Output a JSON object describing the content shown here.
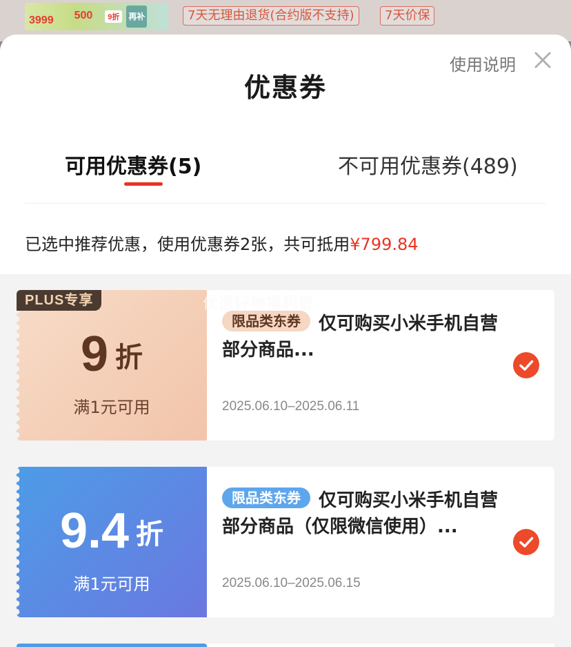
{
  "background": {
    "banner": {
      "left_price": "3999",
      "mid_value": "500",
      "tag": "9折",
      "right": "再补"
    },
    "chips": [
      "7天无理由退货(合约版不支持)",
      "7天价保"
    ]
  },
  "sheet": {
    "title": "优惠券",
    "help_label": "使用说明",
    "close_icon": "close-icon",
    "tabs": [
      {
        "label": "可用优惠券(5)",
        "active": true
      },
      {
        "label": "不可用优惠券(489)",
        "active": false
      }
    ],
    "summary": {
      "text": "已选中推荐优惠，使用优惠券2张，共可抵用",
      "amount": "¥799.84"
    },
    "watermark": "优选好物福利官",
    "coupons": [
      {
        "badge": "PLUS专享",
        "discount": "9",
        "unit": "折",
        "threshold": "满1元可用",
        "category": "限品类东券",
        "description": "仅可购买小米手机自营部分商品...",
        "validity": "2025.06.10–2025.06.11",
        "selected": true
      },
      {
        "badge": "",
        "discount": "9.4",
        "unit": "折",
        "threshold": "满1元可用",
        "category": "限品类东券",
        "description": "仅可购买小米手机自营部分商品（仅限微信使用）...",
        "validity": "2025.06.10–2025.06.15",
        "selected": true
      }
    ]
  },
  "colors": {
    "accent": "#e93323",
    "check": "#ec4a2a",
    "peach": "#f2c4aa",
    "blue": "#5b8ae4"
  }
}
